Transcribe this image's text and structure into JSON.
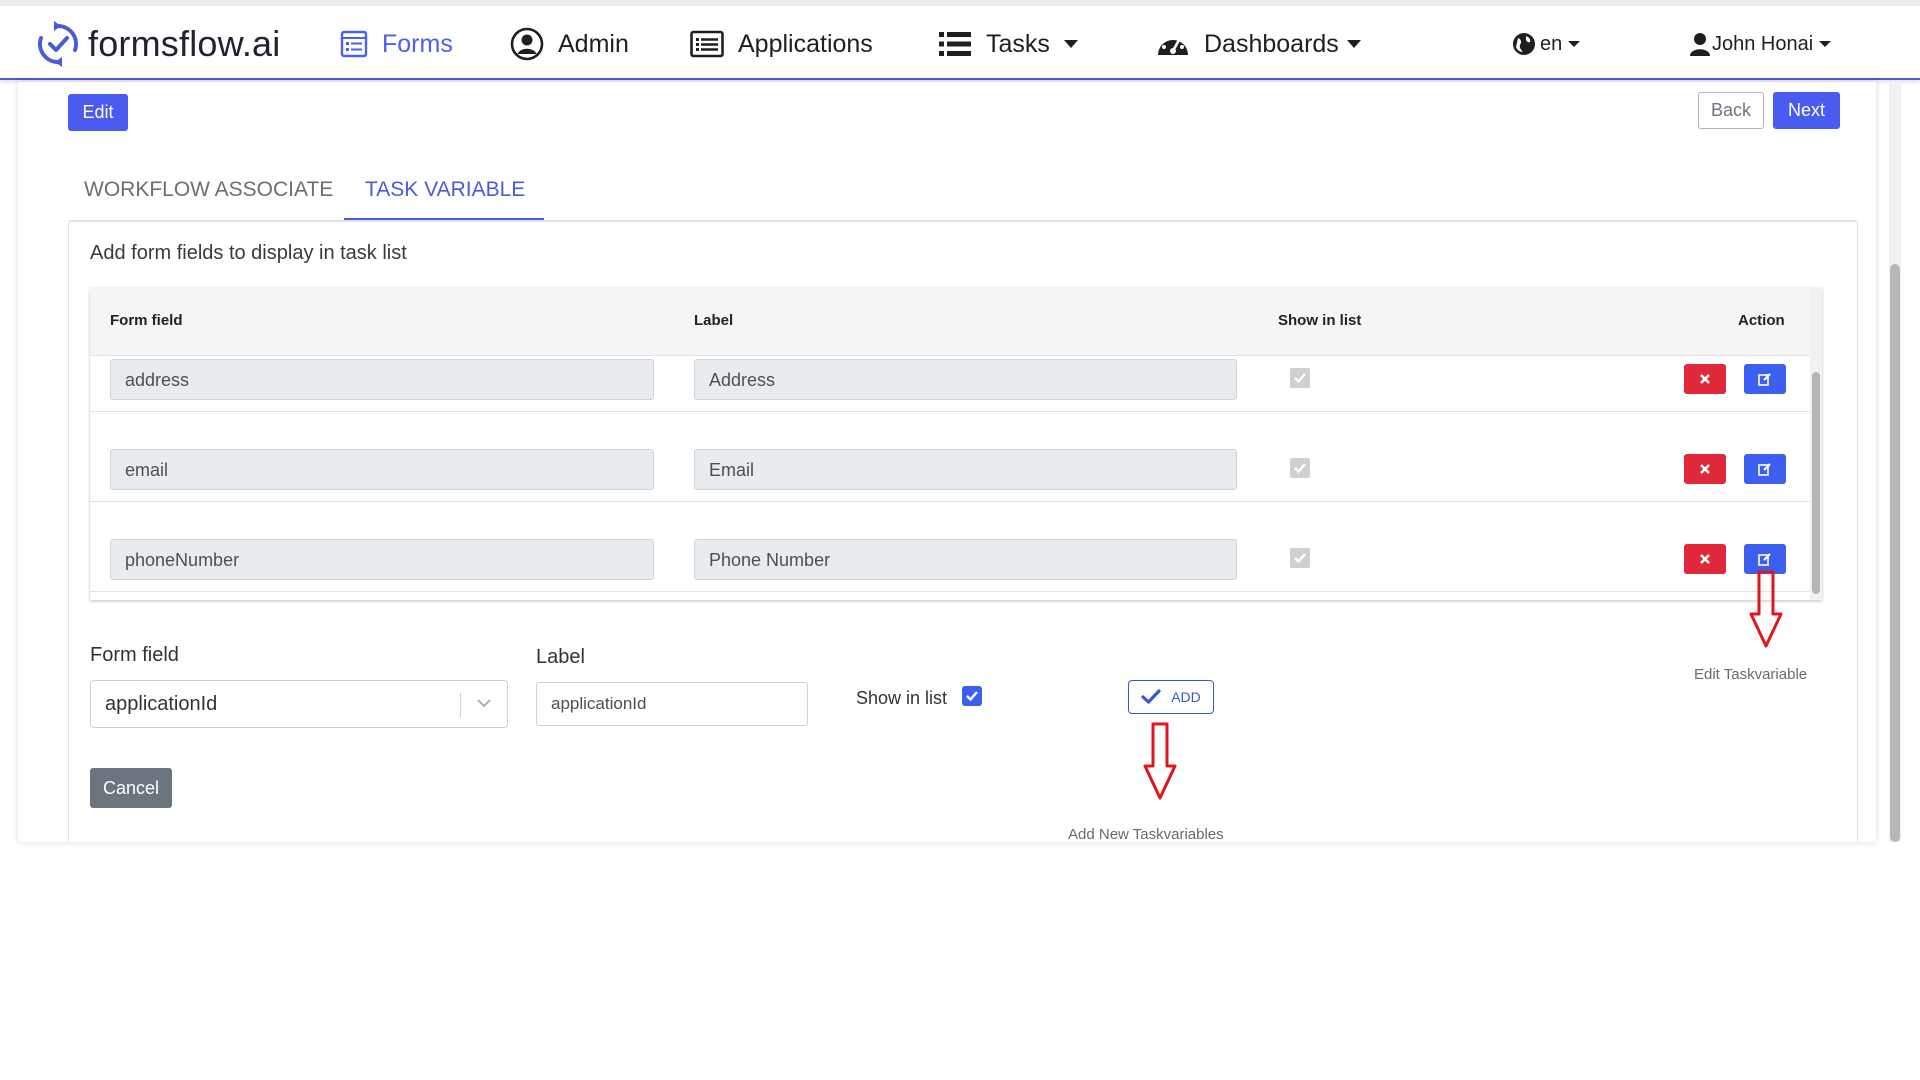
{
  "nav": {
    "brand": "formsflow.ai",
    "forms": "Forms",
    "admin": "Admin",
    "applications": "Applications",
    "tasks": "Tasks",
    "dashboards": "Dashboards",
    "language": "en",
    "user": "John Honai",
    "accent_color": "#4b5ff0"
  },
  "toolbar": {
    "edit": "Edit",
    "back": "Back",
    "next": "Next"
  },
  "tabs": {
    "workflow": "WORKFLOW ASSOCIATE",
    "task_variable": "TASK VARIABLE",
    "active": "TASK VARIABLE"
  },
  "task_variables": {
    "title": "Add form fields to display in task list",
    "columns": {
      "form_field": "Form field",
      "label": "Label",
      "show_in_list": "Show in list",
      "action": "Action"
    },
    "rows": [
      {
        "form_field": "address",
        "label": "Address",
        "show_in_list": true
      },
      {
        "form_field": "email",
        "label": "Email",
        "show_in_list": true
      },
      {
        "form_field": "phoneNumber",
        "label": "Phone Number",
        "show_in_list": true
      }
    ]
  },
  "add_form": {
    "form_field_label": "Form field",
    "form_field_value": "applicationId",
    "label_label": "Label",
    "label_value": "applicationId",
    "show_in_list_label": "Show in list",
    "show_in_list_checked": true,
    "add_button": "ADD",
    "cancel_button": "Cancel"
  },
  "annotations": {
    "edit_taskvariable": "Edit Taskvariable",
    "add_new_taskvariables": "Add New Taskvariables",
    "arrow_color": "#e0161c"
  }
}
